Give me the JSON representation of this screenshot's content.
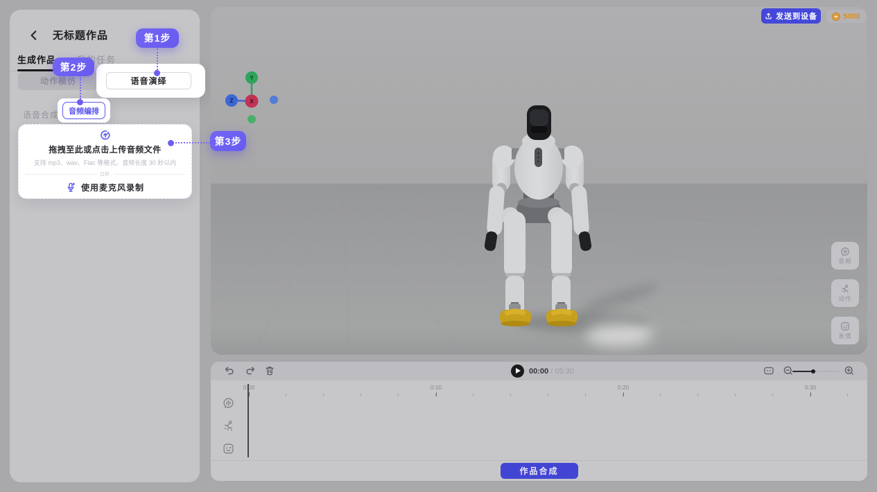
{
  "sidebar": {
    "title": "无标题作品",
    "tabs": [
      {
        "label": "生成作品",
        "active": true
      },
      {
        "label": "我的任务",
        "active": false
      }
    ],
    "mode_toggle": [
      {
        "label": "动作模仿",
        "highlighted": false
      },
      {
        "label": "语音演绎",
        "highlighted": true
      }
    ],
    "sub_tabs": [
      {
        "label": "语音合成",
        "active": false
      },
      {
        "label": "音频编排",
        "active": true
      }
    ],
    "upload": {
      "title": "拖拽至此或点击上传音频文件",
      "hint": "支持 mp3、wav、Flac 等格式，音频长度 30 秒以内",
      "divider": "OR",
      "record_label": "使用麦克风录制"
    }
  },
  "steps": [
    {
      "label": "第1步"
    },
    {
      "label": "第2步"
    },
    {
      "label": "第3步"
    }
  ],
  "viewport": {
    "send_label": "发送到设备",
    "credits": "5000",
    "gizmo": {
      "x": "X",
      "y": "Y",
      "z": "Z"
    },
    "side_tools": [
      {
        "label": "音频"
      },
      {
        "label": "动作"
      },
      {
        "label": "表情"
      }
    ]
  },
  "timeline": {
    "current_time": "00:00",
    "separator": "/",
    "total_time": "05:30",
    "ruler": [
      "0:00",
      "0:10",
      "0:20",
      "0:30"
    ],
    "tracks": [
      "音频",
      "动作",
      "表情"
    ],
    "compose_label": "作品合成"
  },
  "icons": {
    "back": "chevron-left",
    "upload_area": "circular-arrow-upload",
    "record": "microphone-plus",
    "send": "upload-tray",
    "credits": "coin",
    "audio": "audio-circle",
    "motion": "motion-figure",
    "expression": "smiley-square",
    "undo": "undo-arrow",
    "redo": "redo-arrow",
    "delete": "trash",
    "play": "play",
    "fit": "fit-range",
    "zoom_out": "magnifier-minus",
    "zoom_in": "magnifier-plus"
  },
  "colors": {
    "accent_purple": "#6E5FF1",
    "outline_purple": "#5B55EE",
    "primary_indigo": "#4448DA",
    "coin_orange": "#D3912C",
    "axis_x": "#C13354",
    "axis_y": "#2FA45A",
    "axis_z": "#3E66D4"
  }
}
